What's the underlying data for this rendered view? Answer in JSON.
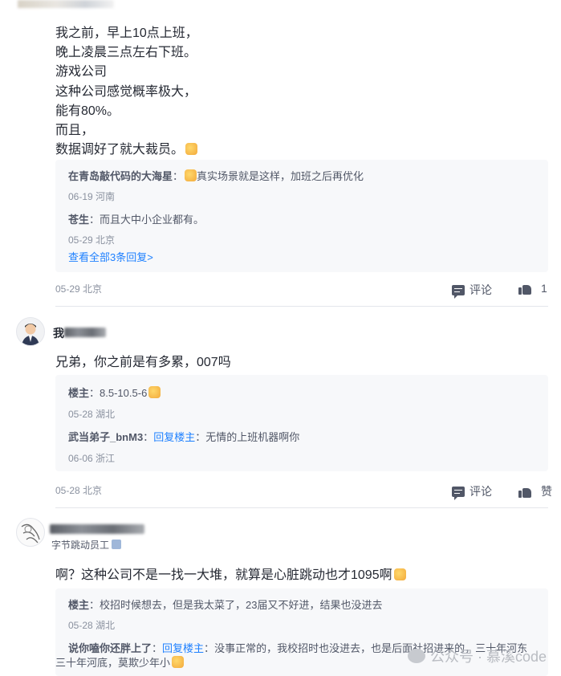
{
  "post1": {
    "lines": [
      "我之前，早上10点上班，",
      "晚上凌晨三点左右下班。",
      "游戏公司",
      "这种公司感觉概率极大，",
      "能有80%。",
      "而且，",
      "数据调好了就大裁员。"
    ],
    "replies": [
      {
        "name": "在青岛敲代码的大海星",
        "text": "真实场景就是这样，加班之后再优化",
        "meta": "06-19 河南"
      },
      {
        "name": "苍生",
        "text": "而且大中小企业都有。",
        "meta": "05-29 北京"
      }
    ],
    "view_all": "查看全部3条回复>",
    "meta": "05-29 北京",
    "comment_label": "评论",
    "like_count": "1"
  },
  "post2": {
    "user_name_visible": "我",
    "text": "兄弟，你之前是有多累，007吗",
    "replies": [
      {
        "name": "楼主",
        "text": "8.5-10.5-6",
        "meta": "05-28 湖北"
      },
      {
        "name": "武当弟子_bnM3",
        "reply_to_label": "回复楼主",
        "text": "无情的上班机器啊你",
        "meta": "06-06 浙江"
      }
    ],
    "meta": "05-28 北京",
    "comment_label": "评论",
    "like_label": "赞"
  },
  "post3": {
    "title_badge": "字节跳动员工",
    "text": "啊？这种公司不是一找一大堆，就算是心脏跳动也才1095啊",
    "replies": [
      {
        "name": "楼主",
        "text": "校招时候想去，但是我太菜了，23届又不好进，结果也没进去",
        "meta": "05-28 湖北"
      },
      {
        "name": "说你嗑你还胖上了",
        "reply_to_label": "回复楼主",
        "text": "没事正常的，我校招时也没进去，也是后面社招进来的，三十年河东",
        "text2": "三十年河底，莫欺少年小"
      }
    ]
  },
  "watermark": "公众号 · 慕溪code",
  "colors": {
    "accent": "#1e80ff",
    "text": "#252933",
    "muted": "#8a919f",
    "reply_bg": "#f7f8fa"
  }
}
